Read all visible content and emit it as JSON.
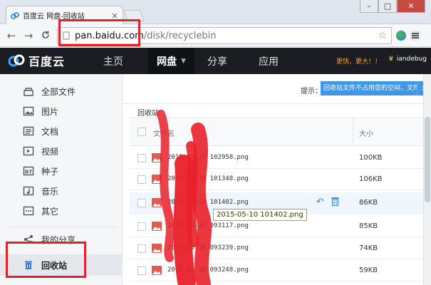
{
  "browser": {
    "tab_title": "百度云 网盘-回收站",
    "tab_close": "×",
    "window_buttons": [
      "–",
      "□",
      "✕"
    ],
    "back": "←",
    "forward": "→",
    "reload": "C",
    "url_host": "pan.baidu.com",
    "url_path": "/disk/recyclebin"
  },
  "header": {
    "logo_text": "百度云",
    "nav": [
      {
        "label": "主页"
      },
      {
        "label": "网盘"
      },
      {
        "label": "分享"
      },
      {
        "label": "应用"
      }
    ],
    "promo": "更快、更大！！",
    "username": "iandebug"
  },
  "sidebar": {
    "items": [
      {
        "label": "全部文件",
        "icon": "folder-icon"
      },
      {
        "label": "图片",
        "icon": "image-icon"
      },
      {
        "label": "文档",
        "icon": "document-icon"
      },
      {
        "label": "视频",
        "icon": "video-icon"
      },
      {
        "label": "种子",
        "icon": "torrent-icon"
      },
      {
        "label": "音乐",
        "icon": "music-icon"
      },
      {
        "label": "其它",
        "icon": "more-icon"
      },
      {
        "label": "我的分享",
        "icon": "share-icon"
      },
      {
        "label": "回收站",
        "icon": "trash-icon"
      }
    ]
  },
  "main": {
    "tip_label": "提示：",
    "tip_text": "回收站文件不占用您的空间，文件保",
    "tip_close": "×",
    "breadcrumb": "回收站",
    "columns": {
      "name": "文件名",
      "size": "大小"
    },
    "rows": [
      {
        "name": "2015-05-10 102958.png",
        "size": "100KB"
      },
      {
        "name": "2015-05-10 101348.png",
        "size": "106KB"
      },
      {
        "name": "2015-05-10 101402.png",
        "size": "86KB"
      },
      {
        "name": "2015-05-10 093117.png",
        "size": "85KB"
      },
      {
        "name": "2015-05-10 093239.png",
        "size": "74KB"
      },
      {
        "name": "2015-05-10 093248.png",
        "size": "59KB"
      }
    ],
    "tooltip": "2015-05-10 101402.png",
    "restore_icon": "↶",
    "delete_icon": "🗑"
  },
  "colors": {
    "header_bg": "#1c1d22",
    "accent_blue": "#3f97e8",
    "annotation_red": "#e0232b"
  }
}
